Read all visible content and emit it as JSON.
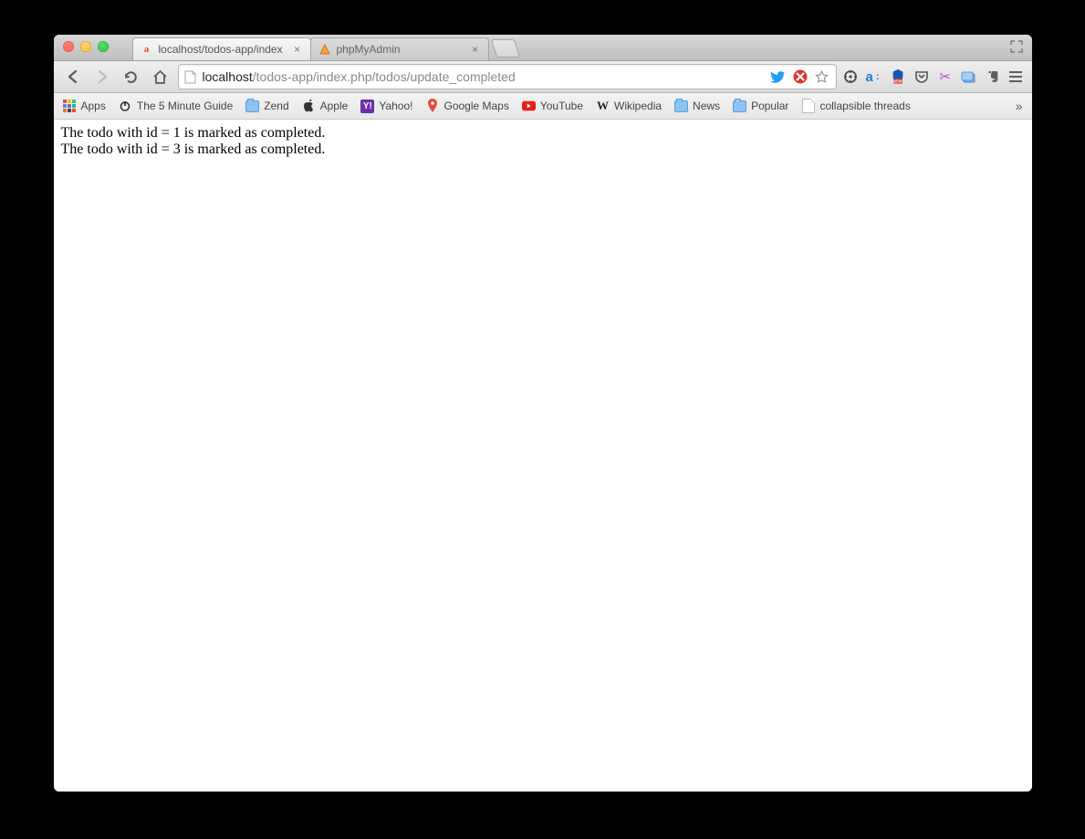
{
  "tabs": [
    {
      "title": "localhost/todos-app/index",
      "favicon": "a",
      "active": true
    },
    {
      "title": "phpMyAdmin",
      "favicon": "pma",
      "active": false
    }
  ],
  "url": {
    "host": "localhost",
    "path": "/todos-app/index.php/todos/update_completed"
  },
  "bookmarks": {
    "apps_label": "Apps",
    "items": [
      {
        "label": "The 5 Minute Guide",
        "icon": "power"
      },
      {
        "label": "Zend",
        "icon": "folder"
      },
      {
        "label": "Apple",
        "icon": "apple"
      },
      {
        "label": "Yahoo!",
        "icon": "yahoo"
      },
      {
        "label": "Google Maps",
        "icon": "gmaps"
      },
      {
        "label": "YouTube",
        "icon": "youtube"
      },
      {
        "label": "Wikipedia",
        "icon": "wikipedia"
      },
      {
        "label": "News",
        "icon": "folder"
      },
      {
        "label": "Popular",
        "icon": "folder"
      },
      {
        "label": "collapsible threads",
        "icon": "doc"
      }
    ]
  },
  "page": {
    "lines": [
      "The todo with id = 1 is marked as completed.",
      "The todo with id = 3 is marked as completed."
    ]
  }
}
